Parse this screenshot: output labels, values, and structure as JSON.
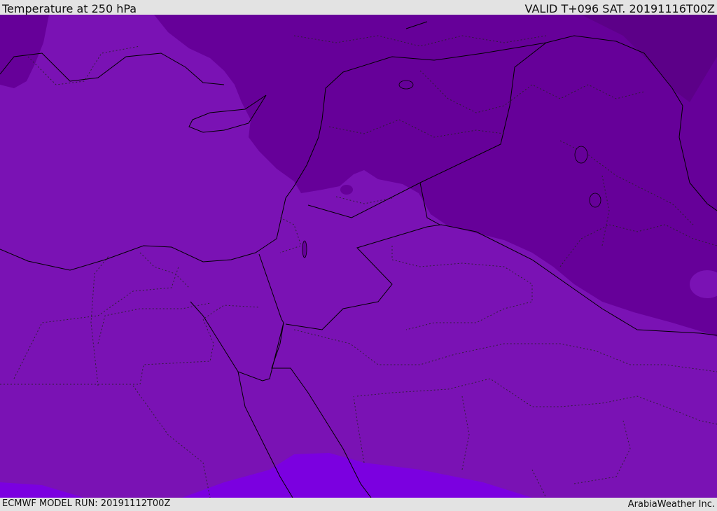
{
  "header": {
    "title": "Temperature at 250 hPa",
    "valid_time": "VALID T+096 SAT. 20191116T00Z"
  },
  "footer": {
    "model_run": "ECMWF MODEL RUN: 20191112T00Z",
    "credit": "ArabiaWeather Inc."
  },
  "map": {
    "colors": {
      "base_band": "#7a12b4",
      "cold_band": "#660099",
      "colder_band": "#5c0088",
      "warm_band": "#7b00e0",
      "land_border": "#000000"
    }
  }
}
